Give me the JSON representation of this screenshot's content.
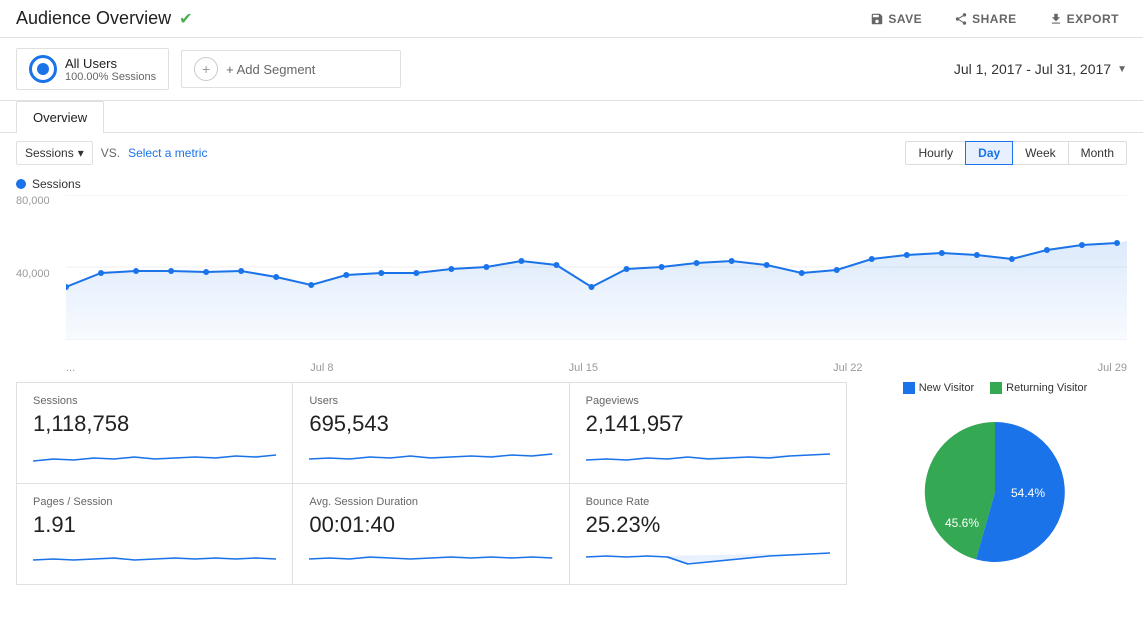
{
  "header": {
    "title": "Audience Overview",
    "verified": true,
    "save_label": "SAVE",
    "share_label": "SHARE",
    "export_label": "EXPORT"
  },
  "segments": {
    "all_users_name": "All Users",
    "all_users_pct": "100.00% Sessions",
    "add_segment_label": "+ Add Segment",
    "date_range": "Jul 1, 2017 - Jul 31, 2017"
  },
  "tabs": [
    {
      "label": "Overview",
      "active": true
    }
  ],
  "controls": {
    "metric_label": "Sessions",
    "vs_label": "VS.",
    "select_metric_label": "Select a metric",
    "periods": [
      {
        "label": "Hourly",
        "active": false
      },
      {
        "label": "Day",
        "active": true
      },
      {
        "label": "Week",
        "active": false
      },
      {
        "label": "Month",
        "active": false
      }
    ]
  },
  "chart": {
    "legend_label": "Sessions",
    "y_axis": [
      "80,000",
      "40,000",
      ""
    ],
    "x_labels": [
      "...",
      "Jul 8",
      "Jul 15",
      "Jul 22",
      "Jul 29"
    ]
  },
  "metrics": [
    {
      "title": "Sessions",
      "value": "1,118,758"
    },
    {
      "title": "Users",
      "value": "695,543"
    },
    {
      "title": "Pageviews",
      "value": "2,141,957"
    },
    {
      "title": "Pages / Session",
      "value": "1.91"
    },
    {
      "title": "Avg. Session Duration",
      "value": "00:01:40"
    },
    {
      "title": "Bounce Rate",
      "value": "25.23%"
    }
  ],
  "pie": {
    "new_visitor_label": "New Visitor",
    "returning_visitor_label": "Returning Visitor",
    "new_visitor_pct": "54.4%",
    "returning_visitor_pct": "45.6%",
    "new_visitor_color": "#1a73e8",
    "returning_visitor_color": "#34a853"
  }
}
